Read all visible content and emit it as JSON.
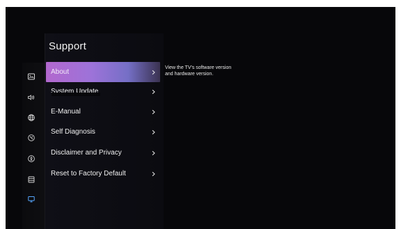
{
  "panel": {
    "title": "Support"
  },
  "sidebar": {
    "icons": [
      {
        "name": "picture-icon"
      },
      {
        "name": "sound-icon"
      },
      {
        "name": "general-globe-icon"
      },
      {
        "name": "privacy-shield-icon"
      },
      {
        "name": "accessibility-icon"
      },
      {
        "name": "menu-list-icon"
      },
      {
        "name": "support-tv-icon"
      }
    ]
  },
  "menu": {
    "items": [
      {
        "label": "About",
        "selected": true
      },
      {
        "label": "System Update",
        "selected": false
      },
      {
        "label": "E-Manual",
        "selected": false
      },
      {
        "label": "Self Diagnosis",
        "selected": false
      },
      {
        "label": "Disclaimer and Privacy",
        "selected": false
      },
      {
        "label": "Reset to Factory Default",
        "selected": false
      }
    ],
    "chevron": "›"
  },
  "description": {
    "text": "View the TV's software version and hardware version."
  },
  "colors": {
    "background": "#07070a",
    "selected_start": "#b268ce",
    "selected_mid": "#9d73d9",
    "selected_end": "#756fc6",
    "active_icon": "#57a7ff",
    "text": "#f0f0f0"
  }
}
